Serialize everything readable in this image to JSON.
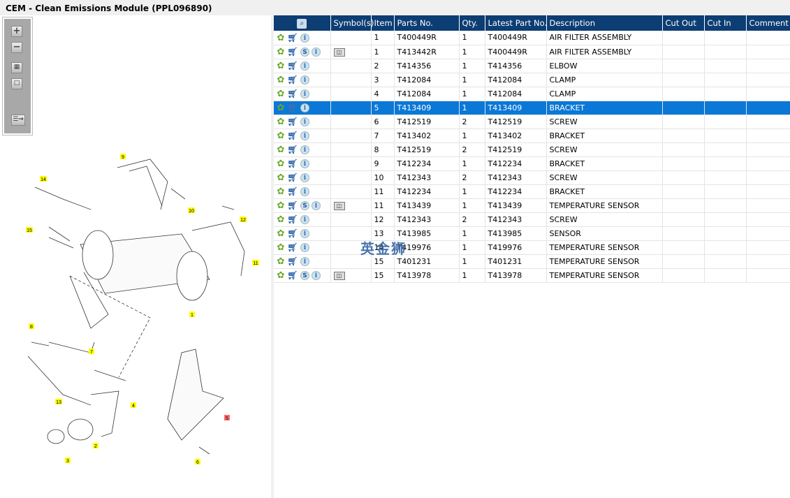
{
  "title": "CEM - Clean Emissions Module (PPL096890)",
  "toolbar": {
    "zoom_in": "+",
    "zoom_out": "−"
  },
  "diagram_callouts": [
    "9",
    "14",
    "10",
    "12",
    "15",
    "11",
    "1",
    "8",
    "7",
    "4",
    "13",
    "2",
    "5",
    "3",
    "6"
  ],
  "table": {
    "headers": [
      "",
      "Symbol(s)",
      "Item",
      "Parts No.",
      "Qty.",
      "Latest Part No.",
      "Description",
      "Cut Out",
      "Cut In",
      "Comment"
    ],
    "rows": [
      {
        "s": false,
        "book": false,
        "item": "1",
        "part": "T400449R",
        "qty": "1",
        "latest": "T400449R",
        "desc": "AIR FILTER ASSEMBLY"
      },
      {
        "s": true,
        "book": true,
        "item": "1",
        "part": "T413442R",
        "qty": "1",
        "latest": "T400449R",
        "desc": "AIR FILTER ASSEMBLY"
      },
      {
        "s": false,
        "book": false,
        "item": "2",
        "part": "T414356",
        "qty": "1",
        "latest": "T414356",
        "desc": "ELBOW"
      },
      {
        "s": false,
        "book": false,
        "item": "3",
        "part": "T412084",
        "qty": "1",
        "latest": "T412084",
        "desc": "CLAMP"
      },
      {
        "s": false,
        "book": false,
        "item": "4",
        "part": "T412084",
        "qty": "1",
        "latest": "T412084",
        "desc": "CLAMP"
      },
      {
        "s": false,
        "book": false,
        "item": "5",
        "part": "T413409",
        "qty": "1",
        "latest": "T413409",
        "desc": "BRACKET",
        "selected": true
      },
      {
        "s": false,
        "book": false,
        "item": "6",
        "part": "T412519",
        "qty": "2",
        "latest": "T412519",
        "desc": "SCREW"
      },
      {
        "s": false,
        "book": false,
        "item": "7",
        "part": "T413402",
        "qty": "1",
        "latest": "T413402",
        "desc": "BRACKET"
      },
      {
        "s": false,
        "book": false,
        "item": "8",
        "part": "T412519",
        "qty": "2",
        "latest": "T412519",
        "desc": "SCREW"
      },
      {
        "s": false,
        "book": false,
        "item": "9",
        "part": "T412234",
        "qty": "1",
        "latest": "T412234",
        "desc": "BRACKET"
      },
      {
        "s": false,
        "book": false,
        "item": "10",
        "part": "T412343",
        "qty": "2",
        "latest": "T412343",
        "desc": "SCREW"
      },
      {
        "s": false,
        "book": false,
        "item": "11",
        "part": "T412234",
        "qty": "1",
        "latest": "T412234",
        "desc": "BRACKET"
      },
      {
        "s": true,
        "book": true,
        "item": "11",
        "part": "T413439",
        "qty": "1",
        "latest": "T413439",
        "desc": "TEMPERATURE SENSOR"
      },
      {
        "s": false,
        "book": false,
        "item": "12",
        "part": "T412343",
        "qty": "2",
        "latest": "T412343",
        "desc": "SCREW"
      },
      {
        "s": false,
        "book": false,
        "item": "13",
        "part": "T413985",
        "qty": "1",
        "latest": "T413985",
        "desc": "SENSOR"
      },
      {
        "s": false,
        "book": false,
        "item": "14",
        "part": "T419976",
        "qty": "1",
        "latest": "T419976",
        "desc": "TEMPERATURE SENSOR"
      },
      {
        "s": false,
        "book": false,
        "item": "15",
        "part": "T401231",
        "qty": "1",
        "latest": "T401231",
        "desc": "TEMPERATURE SENSOR"
      },
      {
        "s": true,
        "book": true,
        "item": "15",
        "part": "T413978",
        "qty": "1",
        "latest": "T413978",
        "desc": "TEMPERATURE SENSOR"
      }
    ]
  },
  "watermark": "英金狮",
  "colors": {
    "header": "#0c3d73",
    "selected": "#0b78d7",
    "callout": "#ffff00",
    "callout_selected": "#ff6b6b"
  }
}
